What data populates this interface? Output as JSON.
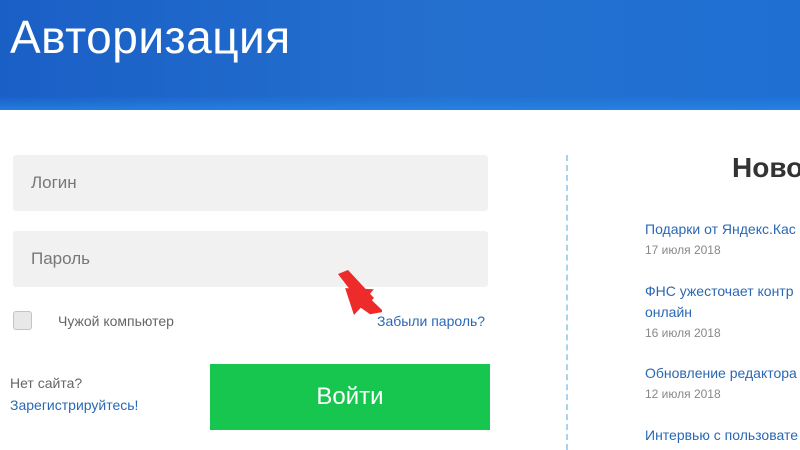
{
  "header": {
    "title": "Авторизация"
  },
  "form": {
    "login_placeholder": "Логин",
    "password_placeholder": "Пароль",
    "remember_label": "Чужой компьютер",
    "forgot_link": "Забыли пароль?",
    "no_site_text": "Нет сайта?",
    "register_link": "Зарегистрируйтесь!",
    "submit_label": "Войти"
  },
  "news": {
    "title": "Ново",
    "items": [
      {
        "title": "Подарки от Яндекс.Кас",
        "date": "17 июля 2018"
      },
      {
        "title": "ФНС ужесточает контр",
        "title2": "онлайн",
        "date": "16 июля 2018"
      },
      {
        "title": "Обновление редактора",
        "date": "12 июля 2018"
      },
      {
        "title": "Интервью с пользовате"
      }
    ]
  },
  "colors": {
    "header": "#1f65c9",
    "button": "#17c64e",
    "link": "#2a68b5",
    "arrow": "#ee2b2b"
  }
}
